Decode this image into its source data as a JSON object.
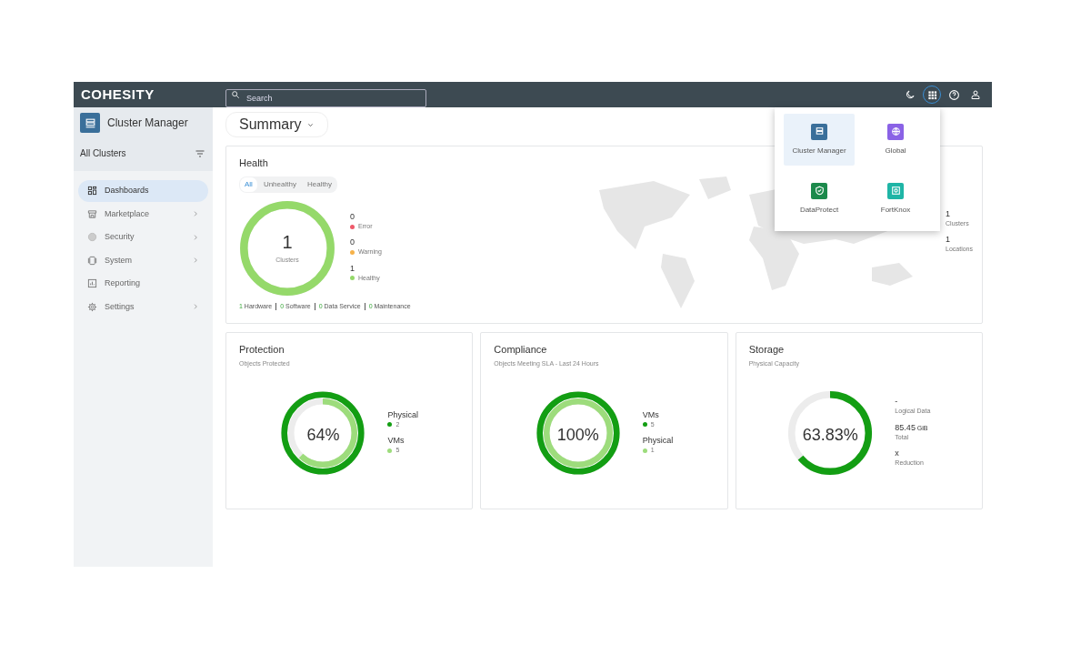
{
  "topbar": {
    "logo": "COHESITY",
    "search": {
      "placeholder": "Search"
    },
    "apps_open": true
  },
  "sidebar": {
    "app_title": "Cluster Manager",
    "scope": "All Clusters",
    "items": [
      {
        "label": "Dashboards",
        "expandable": false,
        "selected": true
      },
      {
        "label": "Marketplace",
        "expandable": true,
        "selected": false
      },
      {
        "label": "Security",
        "expandable": true,
        "selected": false
      },
      {
        "label": "System",
        "expandable": true,
        "selected": false
      },
      {
        "label": "Reporting",
        "expandable": false,
        "selected": false
      },
      {
        "label": "Settings",
        "expandable": true,
        "selected": false
      }
    ]
  },
  "page_title": "Summary",
  "health": {
    "title": "Health",
    "filters": [
      {
        "label": "All",
        "selected": true
      },
      {
        "label": "Unhealthy",
        "selected": false
      },
      {
        "label": "Healthy",
        "selected": false
      }
    ],
    "donut": {
      "value": "1",
      "label": "Clusters",
      "rings": [
        {
          "color": "#95d96a",
          "level": 1
        }
      ]
    },
    "legend": [
      {
        "value": "0",
        "label": "Error",
        "color": "#ef5a6a"
      },
      {
        "value": "0",
        "label": "Warning",
        "color": "#f6b24a"
      },
      {
        "value": "1",
        "label": "Healthy",
        "color": "#95d96a"
      }
    ],
    "breakdown": [
      {
        "count": "1",
        "label": "Hardware"
      },
      {
        "count": "0",
        "label": "Software"
      },
      {
        "count": "0",
        "label": "Data Service"
      },
      {
        "count": "0",
        "label": "Maintenance"
      }
    ],
    "stats": [
      {
        "value": "1",
        "label": "Clusters"
      },
      {
        "value": "1",
        "label": "Locations"
      }
    ]
  },
  "cards": [
    {
      "title": "Protection",
      "subtitle": "Objects Protected",
      "donut": {
        "value": "64%",
        "rings": [
          {
            "color": "#139e13",
            "level": 1
          },
          {
            "color": "#9ddc7c",
            "level": 0.62
          }
        ]
      },
      "legend": [
        {
          "label": "Physical",
          "value": "2",
          "color": "#139e13"
        },
        {
          "label": "VMs",
          "value": "5",
          "color": "#9ddc7c"
        }
      ]
    },
    {
      "title": "Compliance",
      "subtitle": "Objects Meeting SLA - Last 24 Hours",
      "donut": {
        "value": "100%",
        "rings": [
          {
            "color": "#139e13",
            "level": 1
          },
          {
            "color": "#9ddc7c",
            "level": 1
          }
        ]
      },
      "legend": [
        {
          "label": "VMs",
          "value": "5",
          "color": "#139e13"
        },
        {
          "label": "Physical",
          "value": "1",
          "color": "#9ddc7c"
        }
      ]
    },
    {
      "title": "Storage",
      "subtitle": "Physical Capacity",
      "donut": {
        "value": "63.83%",
        "rings": [
          {
            "color": "#139e13",
            "level": 0.6383
          }
        ]
      },
      "stats": [
        {
          "value": "-",
          "label": "Logical Data"
        },
        {
          "value": "85.45",
          "unit": "GiB",
          "label": "Total"
        },
        {
          "value": "x",
          "label": "Reduction"
        }
      ]
    }
  ],
  "apps_menu": [
    {
      "label": "Cluster Manager",
      "color": "#3a6f9a",
      "selected": true
    },
    {
      "label": "Global",
      "color": "#8a62e6",
      "selected": false
    },
    {
      "label": "DataProtect",
      "color": "#1c8a4c",
      "selected": false
    },
    {
      "label": "FortKnox",
      "color": "#1fb5a6",
      "selected": false
    }
  ]
}
